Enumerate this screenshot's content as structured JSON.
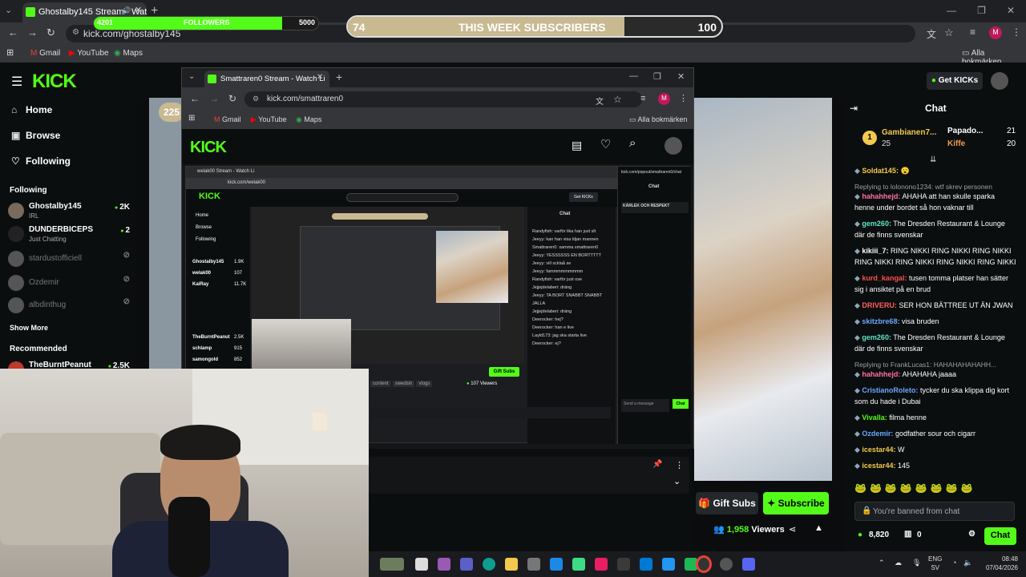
{
  "outer_browser": {
    "tab_title": "Ghostalby145 Stream - Watc",
    "url": "kick.com/ghostalby145",
    "bookmarks": [
      "Gmail",
      "YouTube",
      "Maps"
    ],
    "all_bookmarks": "Alla bokmärken",
    "profile_initial": "M"
  },
  "followers_goal": {
    "label": "FOLLOWERS",
    "current": "4201",
    "target": "5000",
    "progress": 0.84
  },
  "subs_goal": {
    "label": "THIS WEEK SUBSCRIBERS",
    "current": "74",
    "target": "100",
    "progress": 0.74
  },
  "kick": {
    "logo": "KICK",
    "nav": {
      "home": "Home",
      "browse": "Browse",
      "following": "Following"
    },
    "following_title": "Following",
    "following_list": [
      {
        "name": "Ghostalby145",
        "sub": "IRL",
        "count": "2K",
        "live": true
      },
      {
        "name": "DUNDERBICEPS",
        "sub": "Just Chatting",
        "count": "2",
        "live": true
      },
      {
        "name": "stardustofficiell",
        "sub": "",
        "count": "",
        "live": false
      },
      {
        "name": "Ozdemir",
        "sub": "",
        "count": "",
        "live": false
      },
      {
        "name": "albdinthug",
        "sub": "",
        "count": "",
        "live": false
      }
    ],
    "show_more": "Show More",
    "recommended_title": "Recommended",
    "recommended_list": [
      {
        "name": "TheBurntPeanut",
        "count": "2.5K"
      }
    ],
    "get_kicks": "Get KICKs",
    "video_pill": "225",
    "gift_subs": "Gift Subs",
    "subscribe": "Subscribe",
    "viewers_count": "1,958",
    "viewers_label": "Viewers"
  },
  "chat": {
    "title": "Chat",
    "top_gifters": [
      {
        "rank": "1",
        "name": "Gambianen7...",
        "count": "25"
      },
      {
        "name": "Papado...",
        "count": "21"
      },
      {
        "name": "Kiffe",
        "count": "20"
      }
    ],
    "messages": [
      {
        "user": "Soldat145:",
        "text": "😮",
        "color": "#f2c94c"
      },
      {
        "reply": "Replying to lolonono1234: wtf skrev personen"
      },
      {
        "user": "hahahhejd:",
        "text": "AHAHA att han skulle sparka henne under bordet så hon vaknar till",
        "color": "#ff6fa8"
      },
      {
        "user": "gem260:",
        "text": "The Dresden Restaurant & Lounge där de finns svenskar",
        "color": "#5ee6c4"
      },
      {
        "user": "kikiii_7:",
        "text": "RING NIKKI RING NIKKI RING NIKKI RING NIKKI RING NIKKI RING NIKKI RING NIKKI",
        "color": "#ffffff"
      },
      {
        "user": "kurd_kangal:",
        "text": "tusen tomma platser han sätter sig i ansiktet på en brud",
        "color": "#ff4d4d"
      },
      {
        "user": "DRIVERU:",
        "text": "SER HON BÄTTREE UT ÄN JWAN",
        "color": "#ff6060"
      },
      {
        "user": "skitzbre68:",
        "text": "visa bruden",
        "color": "#6aa7ff"
      },
      {
        "user": "gem260:",
        "text": "The Dresden Restaurant & Lounge där de finns svenskar",
        "color": "#5ee6c4"
      },
      {
        "reply": "Replying to FrankLucas1: HAHAHAHAHAHH..."
      },
      {
        "user": "hahahhejd:",
        "text": "AHAHAHA jaaaa",
        "color": "#ff6fa8"
      },
      {
        "user": "CristianoRoleto:",
        "text": "tycker du ska klippa dig kort som du hade i Dubai",
        "color": "#6aa7ff"
      },
      {
        "user": "Vivalla:",
        "text": "filma henne",
        "color": "#53fc18"
      },
      {
        "user": "Ozdemir:",
        "text": "godfather sour och cigarr",
        "color": "#6aa7ff"
      },
      {
        "user": "icestar44:",
        "text": "W",
        "color": "#f2c94c"
      },
      {
        "user": "icestar44:",
        "text": "145",
        "color": "#f2c94c"
      }
    ],
    "banned": "You're banned from chat",
    "kicks_balance": "8,820",
    "subs_count": "0",
    "chat_button": "Chat"
  },
  "inner_browser": {
    "tab_title": "Smattraren0 Stream - Watch Li",
    "url": "kick.com/smattraren0",
    "bookmarks": [
      "Gmail",
      "YouTube",
      "Maps"
    ],
    "all_bookmarks": "Alla bokmärken",
    "profile_initial": "M",
    "logo": "KICK"
  },
  "nested": {
    "url": "kick.com/welak00",
    "streamer": "welak00",
    "viewers": "107 Viewers",
    "gift_subs": "Gift Subs",
    "tags": [
      "content",
      "swedish",
      "vlogs"
    ],
    "chat_label": "Chat",
    "get_kicks": "Get KICKs",
    "sidebar_items": [
      "Home",
      "Browse",
      "Following"
    ],
    "following": [
      {
        "name": "Ghostalby145",
        "count": "1.9K"
      },
      {
        "name": "welak00",
        "count": "107"
      },
      {
        "name": "KaiRay",
        "count": "11.7K"
      }
    ],
    "recommended": [
      {
        "name": "TheBurntPeanut",
        "count": "2.5K"
      },
      {
        "name": "schlamp",
        "count": "915"
      },
      {
        "name": "samongold",
        "count": "852"
      }
    ],
    "chat_snippets": [
      "Randyfish: varför lika han just slt",
      "Jeeyy: kan han visa tiljan mannen",
      "Smattraren0: samma smattraren0",
      "Jeeyy: YESSSSSS EN BORTTTTT",
      "Jeeyy: vill scklaå se",
      "Jeeyy: fammmmmmmmm",
      "Randyfish: varför just ose",
      "Jejjejdelaberi: dräng",
      "Jeeyy: TA BORT SNABBT SNABBT JALLA",
      "Jejjejdelaberi: dräng",
      "Deerocker: hej?",
      "Deerocker: han e live",
      "Layld173: jag ska starta live",
      "Deerocker: ej?"
    ],
    "send_placeholder": "Send a message",
    "pinned": "KÄRLEK OCH RESPEKT"
  },
  "taskbar": {
    "lang_top": "ENG",
    "lang_bottom": "SV",
    "time": "08:48",
    "date": "07/04/2026"
  }
}
